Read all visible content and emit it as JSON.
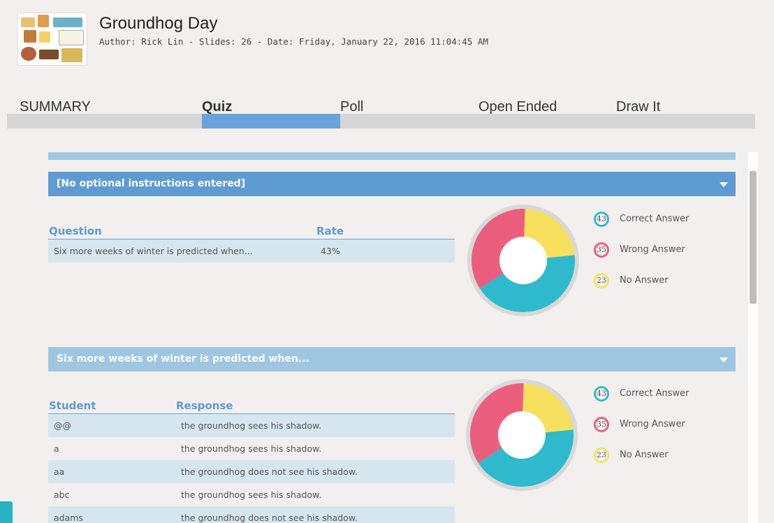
{
  "header": {
    "title": "Groundhog Day",
    "meta": "Author: Rick Lin - Slides: 26 - Date: Friday, January 22, 2016 11:04:45 AM"
  },
  "tabs": [
    {
      "label": "SUMMARY"
    },
    {
      "label": "Quiz"
    },
    {
      "label": "Poll"
    },
    {
      "label": "Open Ended"
    },
    {
      "label": "Draw It"
    }
  ],
  "section1": {
    "bar_label": "[No optional instructions entered]",
    "col_question": "Question",
    "col_rate": "Rate",
    "rows": [
      {
        "question": "Six more weeks of winter is predicted when...",
        "rate": "43%"
      }
    ]
  },
  "section2": {
    "bar_label": "Six more weeks of winter is predicted when...",
    "col_student": "Student",
    "col_response": "Response",
    "rows": [
      {
        "student": "@@",
        "response": "the groundhog sees his shadow."
      },
      {
        "student": "a",
        "response": "the groundhog sees his shadow."
      },
      {
        "student": "aa",
        "response": "the groundhog does not see his shadow."
      },
      {
        "student": "abc",
        "response": "the groundhog sees his shadow."
      },
      {
        "student": "adams",
        "response": "the groundhog does not see his shadow."
      }
    ]
  },
  "legend": [
    {
      "count": "43",
      "label": "Correct Answer",
      "color": "#2eb9cc"
    },
    {
      "count": "35",
      "label": "Wrong Answer",
      "color": "#ec5e7d"
    },
    {
      "count": "23",
      "label": "No Answer",
      "color": "#f6e05e"
    }
  ],
  "chart_data": {
    "type": "pie",
    "categories": [
      "Correct Answer",
      "Wrong Answer",
      "No Answer"
    ],
    "values": [
      43,
      35,
      23
    ],
    "colors": [
      "#2eb9cc",
      "#ec5e7d",
      "#f6e05e"
    ],
    "style": "donut"
  }
}
